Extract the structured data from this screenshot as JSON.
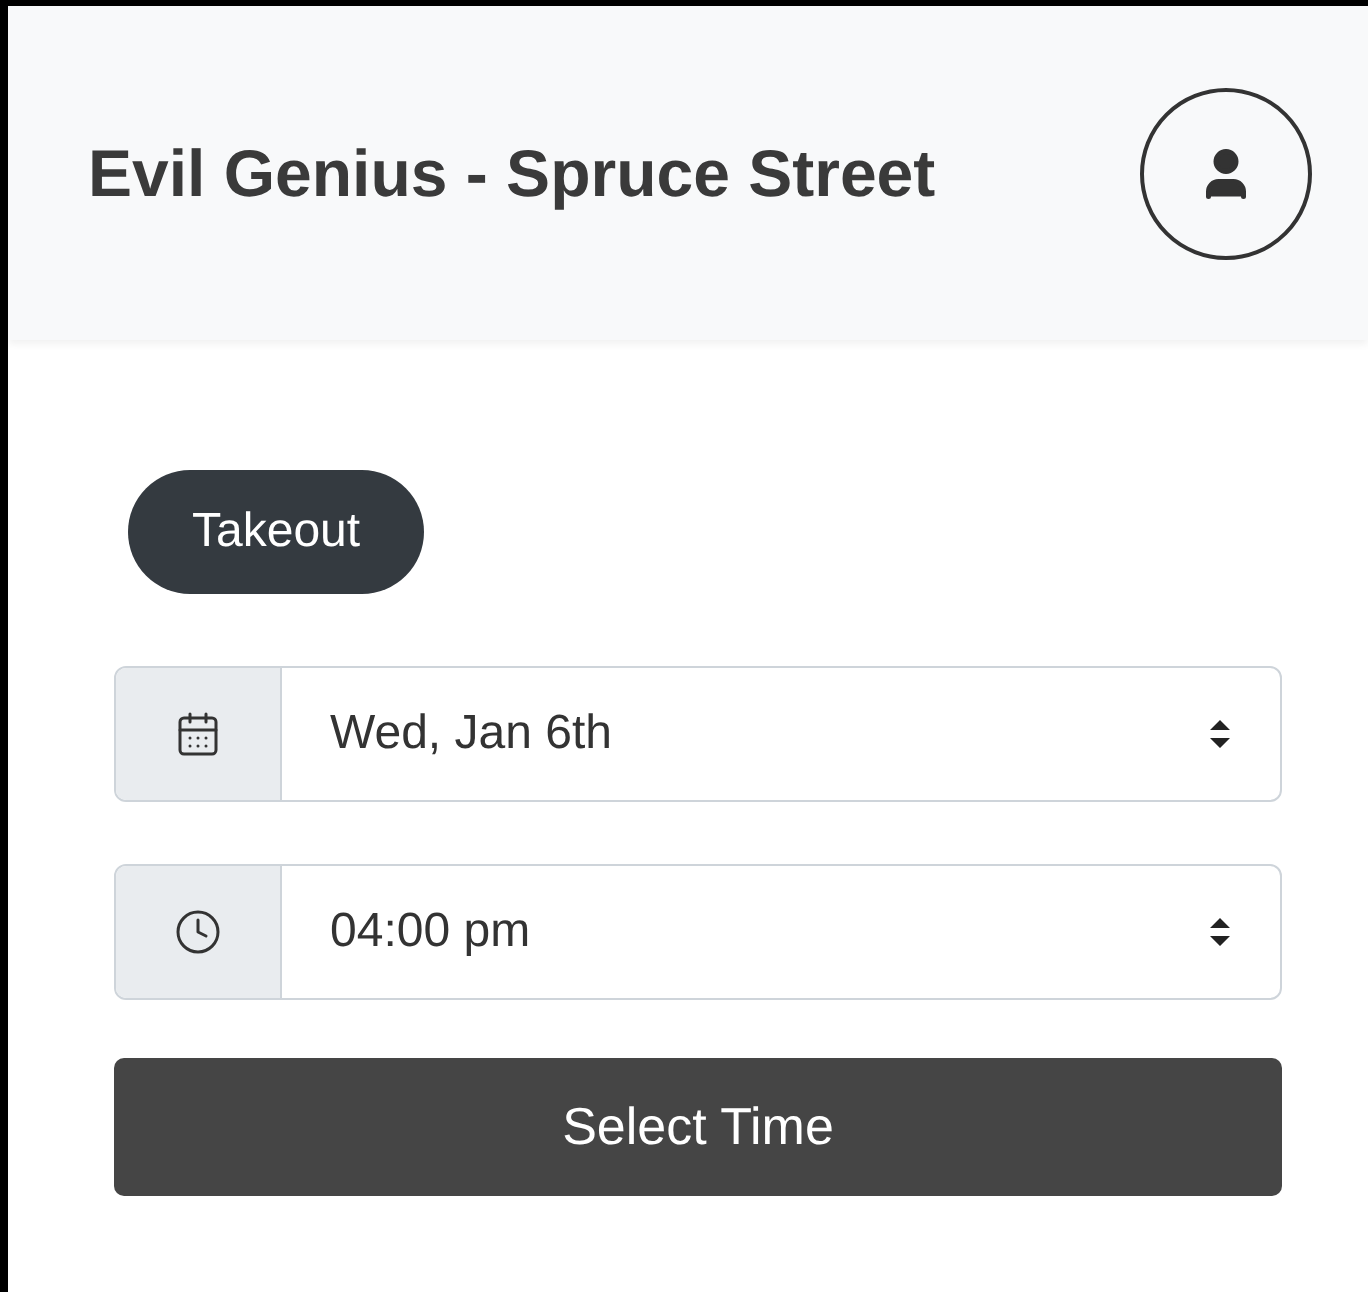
{
  "header": {
    "title": "Evil Genius - Spruce Street"
  },
  "order_type": {
    "label": "Takeout",
    "selected": true
  },
  "selects": [
    {
      "kind": "date",
      "value": "Wed, Jan 6th"
    },
    {
      "kind": "time",
      "value": "04:00 pm"
    }
  ],
  "button": {
    "label": "Select Time"
  }
}
